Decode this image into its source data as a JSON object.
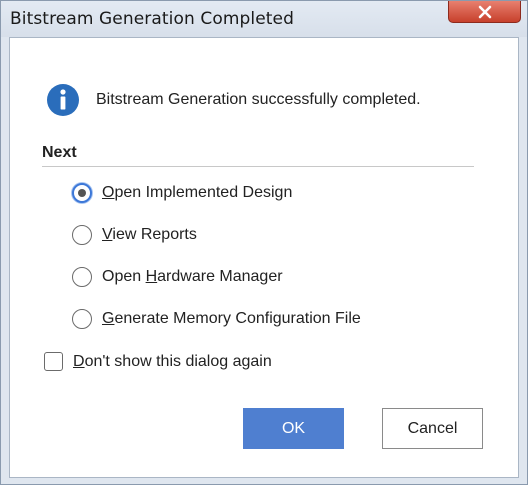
{
  "window": {
    "title": "Bitstream Generation Completed"
  },
  "message": {
    "icon": "info-icon",
    "text": "Bitstream Generation successfully completed."
  },
  "next": {
    "heading": "Next",
    "options": [
      {
        "mnemonic": "O",
        "rest": "pen Implemented Design",
        "before": "",
        "selected": true
      },
      {
        "mnemonic": "V",
        "rest": "iew Reports",
        "before": "",
        "selected": false
      },
      {
        "before": "Open ",
        "mnemonic": "H",
        "rest": "ardware Manager",
        "selected": false
      },
      {
        "mnemonic": "G",
        "rest": "enerate Memory Configuration File",
        "before": "",
        "selected": false
      }
    ]
  },
  "dont_show": {
    "mnemonic": "D",
    "rest": "on't show this dialog again",
    "checked": false
  },
  "buttons": {
    "ok": "OK",
    "cancel": "Cancel"
  },
  "colors": {
    "accent": "#4f7fd0",
    "info_icon": "#2a6dbb",
    "close_button": "#c7402c"
  }
}
